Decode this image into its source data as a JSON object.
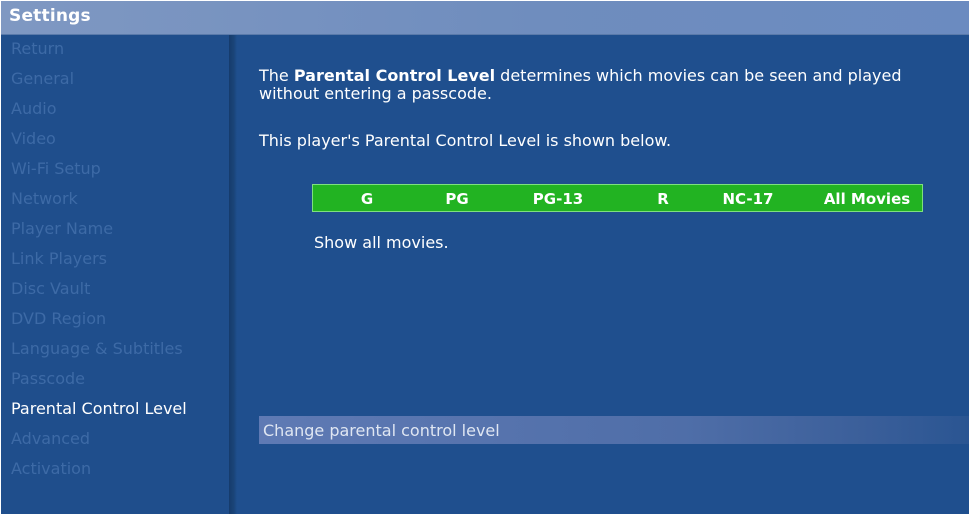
{
  "window": {
    "title": "Settings"
  },
  "sidebar": {
    "items": [
      {
        "label": "Return"
      },
      {
        "label": "General"
      },
      {
        "label": "Audio"
      },
      {
        "label": "Video"
      },
      {
        "label": "Wi-Fi Setup"
      },
      {
        "label": "Network"
      },
      {
        "label": "Player Name"
      },
      {
        "label": "Link Players"
      },
      {
        "label": "Disc Vault"
      },
      {
        "label": "DVD Region"
      },
      {
        "label": "Language & Subtitles"
      },
      {
        "label": "Passcode"
      },
      {
        "label": "Parental Control Level"
      },
      {
        "label": "Advanced"
      },
      {
        "label": "Activation"
      }
    ],
    "selected": "Parental Control Level"
  },
  "main": {
    "intro_prefix": "The ",
    "intro_bold": "Parental Control Level",
    "intro_suffix_line1": " determines which movies can be seen and played",
    "intro_line2": "without entering a passcode.",
    "level_note": "This player's Parental Control Level is shown below.",
    "ratings": [
      "G",
      "PG",
      "PG-13",
      "R",
      "NC-17",
      "All Movies"
    ],
    "current_level": "All Movies",
    "description": "Show all movies.",
    "action_label": "Change parental control level"
  },
  "colors": {
    "background": "#1f4f8e",
    "titlebar": "#7390bf",
    "ratings_bar": "#22b322",
    "inactive_menu_text": "#3d6aa6",
    "active_menu_text": "#ffffff"
  }
}
